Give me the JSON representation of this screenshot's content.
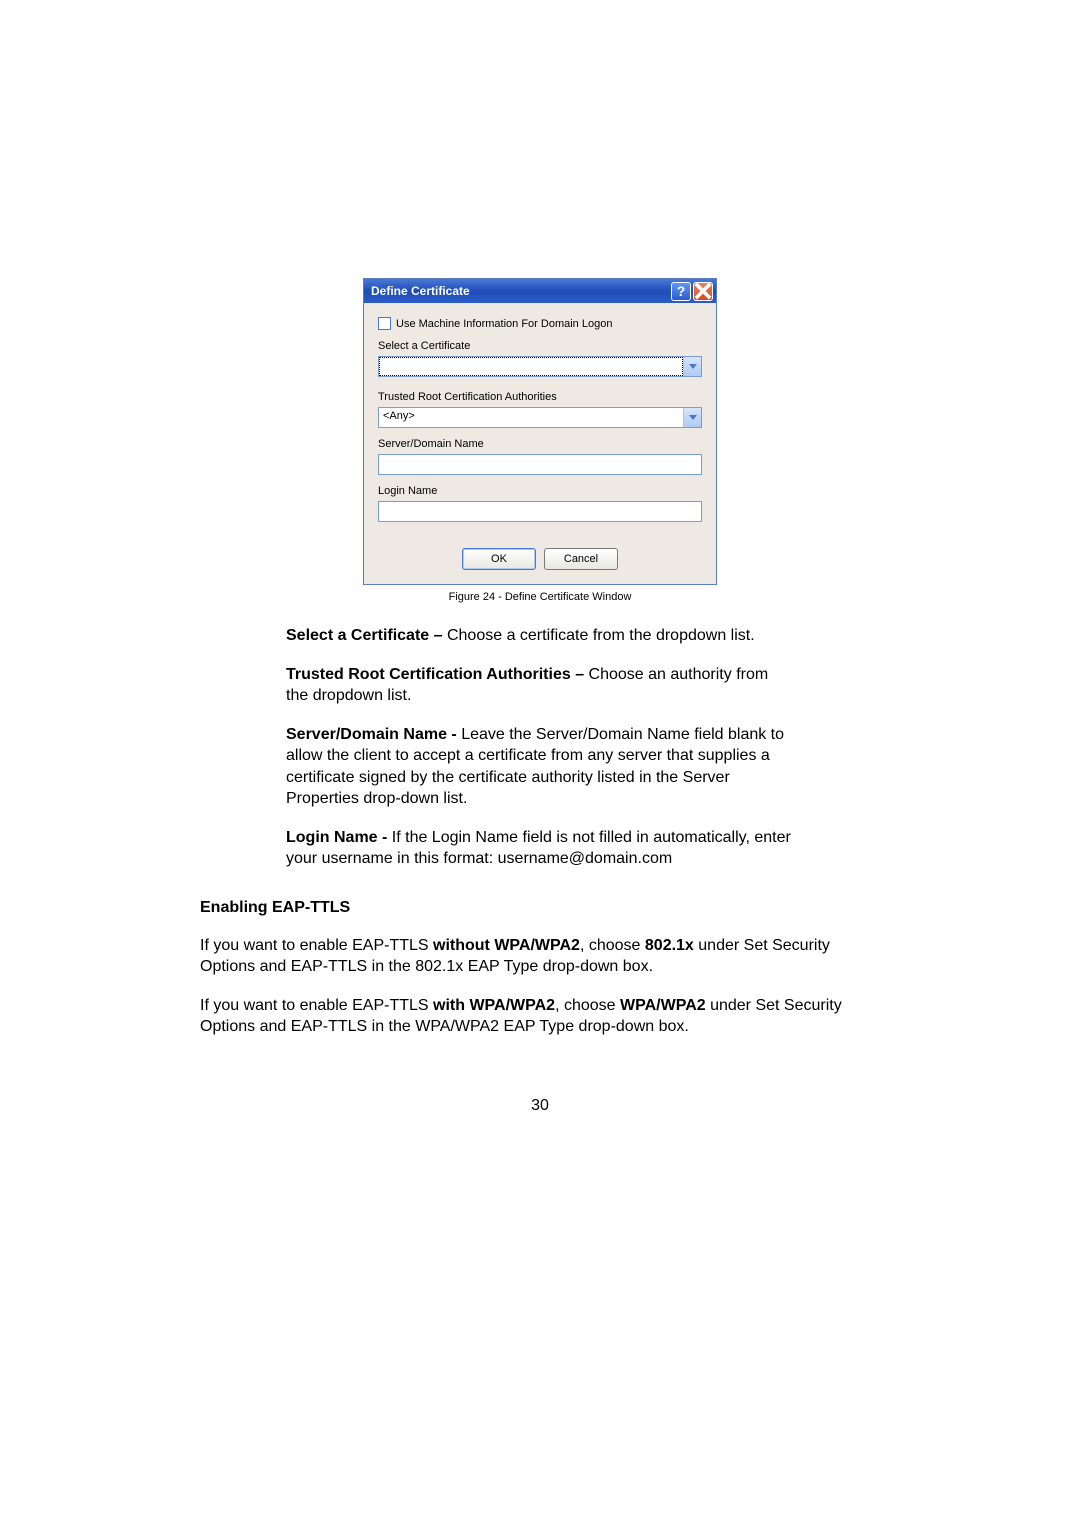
{
  "dialog": {
    "title": "Define Certificate",
    "checkbox_label": "Use Machine Information For Domain Logon",
    "labels": {
      "select_cert": "Select a Certificate",
      "trusted_root": "Trusted Root Certification Authorities",
      "server_domain": "Server/Domain Name",
      "login_name": "Login Name"
    },
    "values": {
      "select_cert": "",
      "trusted_root": "<Any>",
      "server_domain": "",
      "login_name": ""
    },
    "buttons": {
      "ok": "OK",
      "cancel": "Cancel"
    }
  },
  "caption": "Figure 24 - Define Certificate Window",
  "para1": {
    "bold": "Select a Certificate – ",
    "rest": "Choose a certificate from the dropdown list."
  },
  "para2": {
    "bold": "Trusted Root Certification Authorities – ",
    "rest": "Choose an authority from the dropdown list."
  },
  "para3": {
    "bold": "Server/Domain Name - ",
    "rest": "Leave the Server/Domain Name field blank to allow the client to accept a certificate from any server that supplies a certificate signed by the certificate authority listed in the Server Properties drop-down list."
  },
  "para4": {
    "bold": "Login Name - ",
    "rest": "If the Login Name field is not filled in automatically, enter your username in this format: username@domain.com"
  },
  "heading": "Enabling EAP-TTLS",
  "para5": {
    "t1": "If you want to enable EAP-TTLS ",
    "b1": "without WPA/WPA2",
    "t2": ", choose ",
    "b2": "802.1x",
    "t3": " under Set Security Options and EAP-TTLS in the 802.1x EAP Type drop-down box."
  },
  "para6": {
    "t1": "If you want to enable EAP-TTLS ",
    "b1": "with WPA/WPA2",
    "t2": ", choose ",
    "b2": "WPA/WPA2",
    "t3": " under Set Security Options and EAP-TTLS in the WPA/WPA2 EAP Type drop-down box."
  },
  "page_number": "30"
}
